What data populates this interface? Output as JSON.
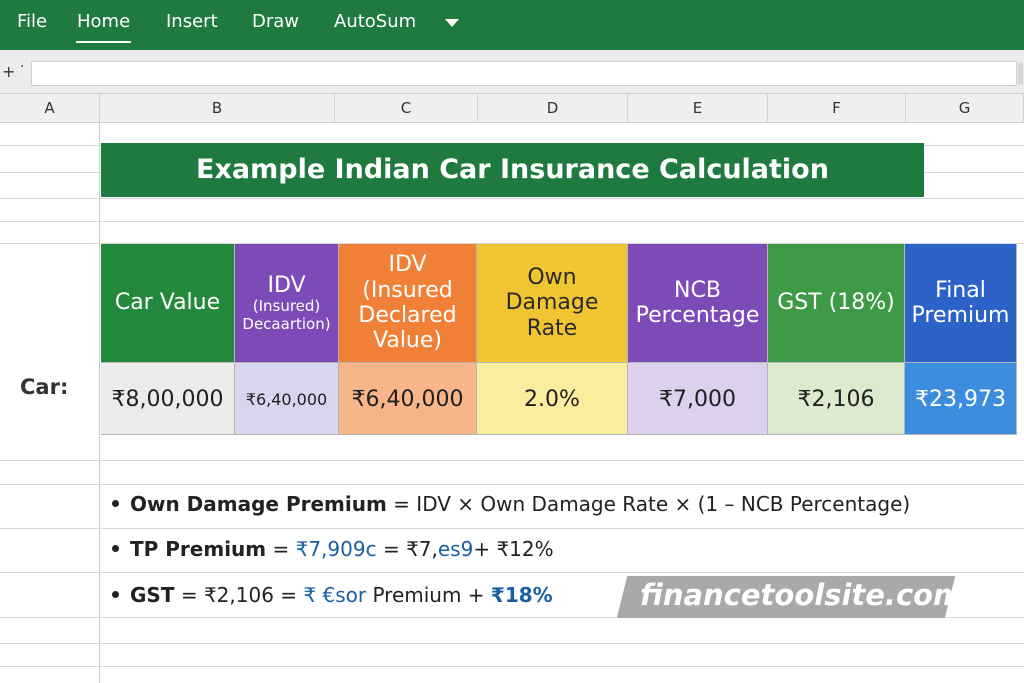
{
  "ribbon": {
    "menu": [
      "File",
      "Home",
      "Insert",
      "Draw",
      "AutoSum"
    ],
    "active": "Home"
  },
  "formula_bar": {
    "plus_glyph": "+",
    "dot_glyph": "·",
    "value": ""
  },
  "columns": [
    "A",
    "B",
    "C",
    "D",
    "E",
    "F",
    "G"
  ],
  "sheet": {
    "title": "Example Indian Car Insurance Calculation",
    "row_label": "Car:",
    "headers": [
      {
        "label": "Car Value",
        "sub": ""
      },
      {
        "label": "IDV",
        "sub": "(Insured) Decaartion)"
      },
      {
        "label": "IDV (Insured Declared Value)",
        "sub": ""
      },
      {
        "label": "Own Damage Rate",
        "sub": ""
      },
      {
        "label": "NCB Percentage",
        "sub": ""
      },
      {
        "label": "GST (18%)",
        "sub": ""
      },
      {
        "label": "Final Premium",
        "sub": ""
      }
    ],
    "values": [
      "₹8,00,000",
      "₹6,40,000",
      "₹6,40,000",
      "2.0%",
      "₹7,000",
      "₹2,106",
      "₹23,973"
    ],
    "header_colors": [
      "#24893d",
      "#7d4bb8",
      "#f07f37",
      "#f1c431",
      "#7d4bb8",
      "#3f9a47",
      "#2d63c9"
    ],
    "value_colors": [
      "#ececec",
      "#d8d6ef",
      "#f9b58a",
      "#faed9e",
      "#ddd0ef",
      "#dcebcf",
      "#3c8ddd"
    ]
  },
  "bullets": {
    "b1_bold": "Own Damage Premium",
    "b1_rest": " = IDV × Own Damage Rate × (1 – NCB Percentage)",
    "b2_bold": "TP Premium",
    "b2_eq": " = ",
    "b2_v1": "₹7,909c",
    "b2_mid": "  = ₹7,",
    "b2_v2": "es9",
    "b2_end": "+ ₹12%",
    "b3_bold": "GST",
    "b3_a": " = ₹2,106  = ",
    "b3_v": "₹ €sor",
    "b3_mid": " Premium + ",
    "b3_pct": "₹18%"
  },
  "watermark": "financetoolsite.com"
}
